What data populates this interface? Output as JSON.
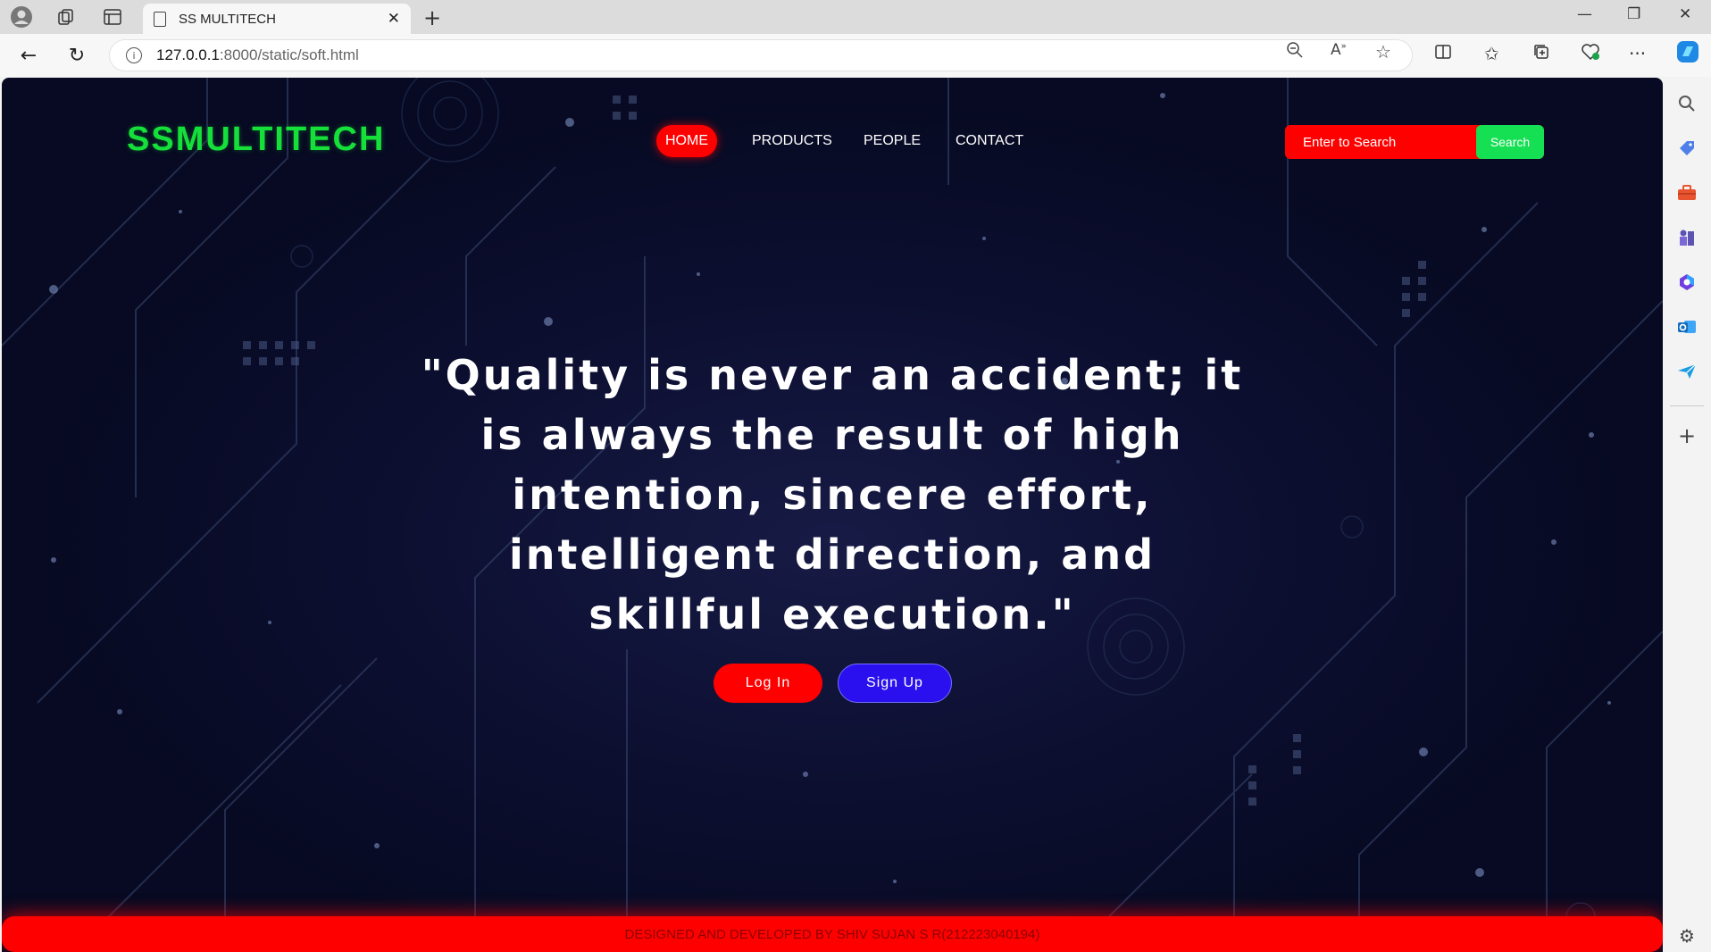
{
  "browser": {
    "tab_title": "SS MULTITECH",
    "url_host": "127.0.0.1",
    "url_path": ":8000/static/soft.html",
    "icons": {
      "profile": "profile-icon",
      "workspaces": "workspaces-icon",
      "tab_actions": "tab-actions-icon",
      "back": "back-arrow-icon",
      "refresh": "refresh-icon",
      "info": "info-icon",
      "zoom": "zoom-out-icon",
      "read_aloud": "read-aloud-icon",
      "favorite": "star-icon"
    }
  },
  "sidebar": {
    "icons": [
      "search-icon",
      "shopping-tag-icon",
      "toolbox-icon",
      "games-icon",
      "microsoft365-icon",
      "outlook-icon",
      "send-icon",
      "add-icon",
      "settings-icon"
    ]
  },
  "page": {
    "logo": "SSMULTITECH",
    "nav": {
      "home": "HOME",
      "products": "PRODUCTS",
      "people": "PEOPLE",
      "contact": "CONTACT"
    },
    "search": {
      "placeholder": "Enter to Search",
      "button": "Search"
    },
    "quote": "\"Quality is never an accident; it is always the result of high intention, sincere effort, intelligent direction, and skillful execution.\"",
    "buttons": {
      "login": "Log In",
      "signup": "Sign Up"
    },
    "footer": "DESIGNED AND DEVELOPED BY SHIV SUJAN S R(212223040194)",
    "colors": {
      "logo": "#15e03a",
      "accent_red": "#ff0000",
      "search_green": "#15e053",
      "signup_blue": "#2a10ee",
      "background": "#0c0f30"
    }
  }
}
